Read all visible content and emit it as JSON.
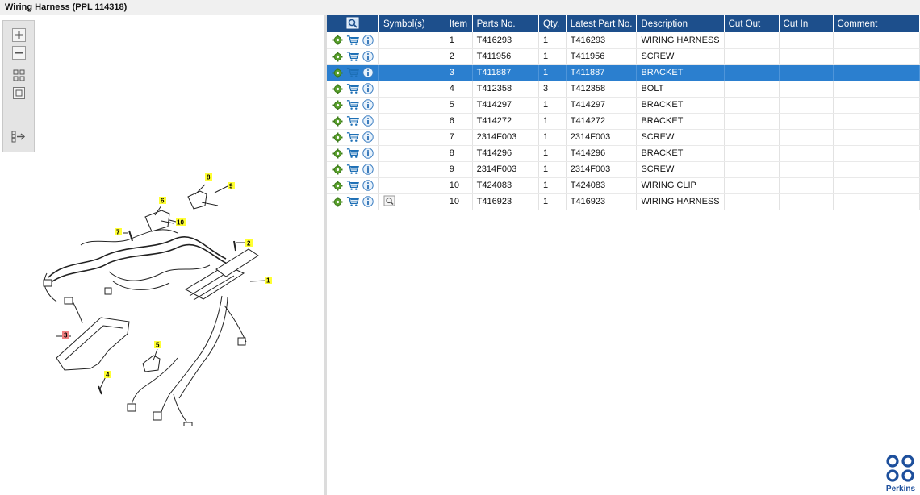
{
  "window": {
    "title": "Wiring Harness (PPL 114318)"
  },
  "viewer_toolbar": {
    "zoom_in": "zoom-in-icon",
    "zoom_out": "zoom-out-icon",
    "fit_all": "fit-all-icon",
    "fit_window": "fit-window-icon",
    "export": "export-icon"
  },
  "drawing": {
    "callouts": [
      "1",
      "2",
      "3",
      "4",
      "5",
      "6",
      "7",
      "8",
      "9",
      "10"
    ],
    "highlighted_callout": "3",
    "colors": {
      "callout": "#ffff33",
      "highlight": "#f08080",
      "line": "#222222"
    }
  },
  "table": {
    "columns": [
      "",
      "Symbol(s)",
      "Item",
      "Parts No.",
      "Qty.",
      "Latest Part No.",
      "Description",
      "Cut Out",
      "Cut In",
      "Comment"
    ],
    "header_icon": "search-parts-icon",
    "row_icons": [
      "gear-icon",
      "cart-icon",
      "info-icon"
    ],
    "selected_index": 2,
    "rows": [
      {
        "symbol": "",
        "item": "1",
        "part_no": "T416293",
        "qty": "1",
        "latest": "T416293",
        "desc": "WIRING HARNESS",
        "cut_out": "",
        "cut_in": "",
        "comment": ""
      },
      {
        "symbol": "",
        "item": "2",
        "part_no": "T411956",
        "qty": "1",
        "latest": "T411956",
        "desc": "SCREW",
        "cut_out": "",
        "cut_in": "",
        "comment": ""
      },
      {
        "symbol": "",
        "item": "3",
        "part_no": "T411887",
        "qty": "1",
        "latest": "T411887",
        "desc": "BRACKET",
        "cut_out": "",
        "cut_in": "",
        "comment": ""
      },
      {
        "symbol": "",
        "item": "4",
        "part_no": "T412358",
        "qty": "3",
        "latest": "T412358",
        "desc": "BOLT",
        "cut_out": "",
        "cut_in": "",
        "comment": ""
      },
      {
        "symbol": "",
        "item": "5",
        "part_no": "T414297",
        "qty": "1",
        "latest": "T414297",
        "desc": "BRACKET",
        "cut_out": "",
        "cut_in": "",
        "comment": ""
      },
      {
        "symbol": "",
        "item": "6",
        "part_no": "T414272",
        "qty": "1",
        "latest": "T414272",
        "desc": "BRACKET",
        "cut_out": "",
        "cut_in": "",
        "comment": ""
      },
      {
        "symbol": "",
        "item": "7",
        "part_no": "2314F003",
        "qty": "1",
        "latest": "2314F003",
        "desc": "SCREW",
        "cut_out": "",
        "cut_in": "",
        "comment": ""
      },
      {
        "symbol": "",
        "item": "8",
        "part_no": "T414296",
        "qty": "1",
        "latest": "T414296",
        "desc": "BRACKET",
        "cut_out": "",
        "cut_in": "",
        "comment": ""
      },
      {
        "symbol": "",
        "item": "9",
        "part_no": "2314F003",
        "qty": "1",
        "latest": "2314F003",
        "desc": "SCREW",
        "cut_out": "",
        "cut_in": "",
        "comment": ""
      },
      {
        "symbol": "",
        "item": "10",
        "part_no": "T424083",
        "qty": "1",
        "latest": "T424083",
        "desc": "WIRING CLIP",
        "cut_out": "",
        "cut_in": "",
        "comment": ""
      },
      {
        "symbol": "magnify-icon",
        "item": "10",
        "part_no": "T416923",
        "qty": "1",
        "latest": "T416923",
        "desc": "WIRING HARNESS",
        "cut_out": "",
        "cut_in": "",
        "comment": ""
      }
    ]
  },
  "brand": {
    "name": "Perkins",
    "color": "#1d4f9c"
  }
}
